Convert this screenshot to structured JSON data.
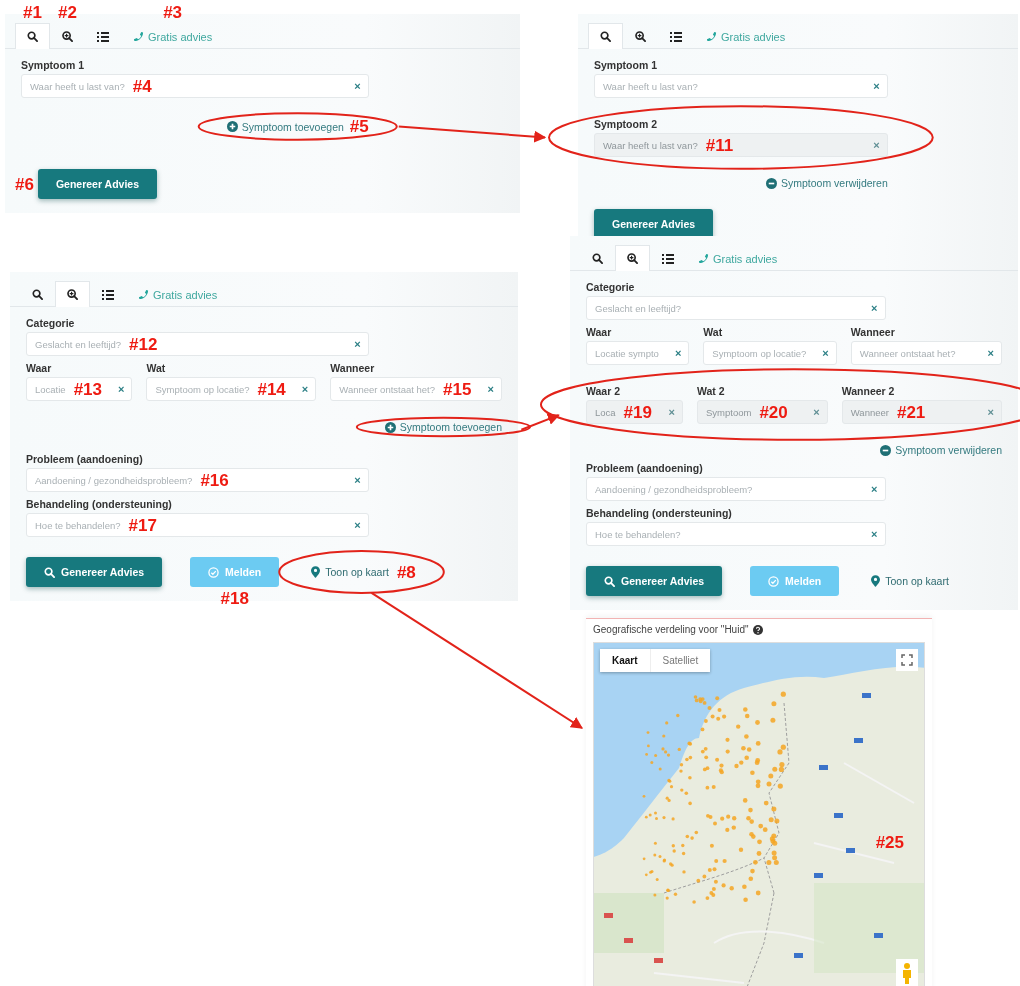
{
  "panels": [
    {
      "tabs": [
        {
          "kind": "search",
          "selected": true,
          "callout": "#1"
        },
        {
          "kind": "zoom",
          "selected": false,
          "callout": "#2"
        },
        {
          "kind": "list",
          "selected": false
        },
        {
          "kind": "phone",
          "label": "Gratis advies",
          "selected": false,
          "callout": "#3"
        }
      ],
      "rows": [
        {
          "kind": "fields",
          "fields": [
            {
              "label": "Symptoom 1",
              "placeholder": "Waar heeft u last van?",
              "clear": "×",
              "disabled": false,
              "callout": "#4"
            }
          ]
        },
        {
          "kind": "add_link",
          "label": "Symptoom toevoegen",
          "callout": "#5"
        }
      ],
      "buttons": [
        {
          "kind": "generate",
          "label": "Genereer Advies",
          "callout": "#6"
        }
      ]
    },
    {
      "tabs": [
        {
          "kind": "search",
          "selected": true
        },
        {
          "kind": "zoom",
          "selected": false
        },
        {
          "kind": "list",
          "selected": false
        },
        {
          "kind": "phone",
          "label": "Gratis advies",
          "selected": false
        }
      ],
      "rows": [
        {
          "kind": "fields",
          "fields": [
            {
              "label": "Symptoom 1",
              "placeholder": "Waar heeft u last van?",
              "clear": "×",
              "disabled": false
            }
          ]
        },
        {
          "kind": "fields",
          "fields": [
            {
              "label": "Symptoom 2",
              "placeholder": "Waar heeft u last van?",
              "clear": "×",
              "disabled": true,
              "callout": "#11"
            }
          ]
        },
        {
          "kind": "remove_link",
          "label": "Symptoom verwijderen"
        }
      ],
      "buttons": [
        {
          "kind": "generate",
          "label": "Genereer Advies"
        }
      ]
    },
    {
      "tabs": [
        {
          "kind": "search",
          "selected": false
        },
        {
          "kind": "zoom",
          "selected": true
        },
        {
          "kind": "list",
          "selected": false
        },
        {
          "kind": "phone",
          "label": "Gratis advies",
          "selected": false
        }
      ],
      "rows": [
        {
          "kind": "fields",
          "fields": [
            {
              "label": "Categorie",
              "placeholder": "Geslacht en leeftijd?",
              "clear": "×",
              "disabled": false,
              "callout": "#12"
            }
          ]
        },
        {
          "kind": "fields",
          "fields": [
            {
              "label": "Waar",
              "placeholder": "Locatie",
              "clear": "×",
              "disabled": false,
              "callout": "#13"
            },
            {
              "label": "Wat",
              "placeholder": "Symptoom op locatie?",
              "clear": "×",
              "disabled": false,
              "callout": "#14"
            },
            {
              "label": "Wanneer",
              "placeholder": "Wanneer ontstaat het?",
              "clear": "×",
              "disabled": false,
              "callout": "#15"
            }
          ]
        },
        {
          "kind": "add_link",
          "label": "Symptoom toevoegen"
        },
        {
          "kind": "fields",
          "fields": [
            {
              "label": "Probleem (aandoening)",
              "placeholder": "Aandoening / gezondheidsprobleem?",
              "clear": "×",
              "disabled": false,
              "callout": "#16"
            }
          ]
        },
        {
          "kind": "fields",
          "fields": [
            {
              "label": "Behandeling (ondersteuning)",
              "placeholder": "Hoe te behandelen?",
              "clear": "×",
              "disabled": false,
              "callout": "#17"
            }
          ]
        }
      ],
      "buttons": [
        {
          "kind": "search",
          "label": "Genereer Advies"
        },
        {
          "kind": "report",
          "label": "Melden",
          "callout": "#18"
        },
        {
          "kind": "map",
          "label": "Toon op kaart",
          "callout": "#8"
        }
      ]
    },
    {
      "tabs": [
        {
          "kind": "search",
          "selected": false
        },
        {
          "kind": "zoom",
          "selected": true
        },
        {
          "kind": "list",
          "selected": false
        },
        {
          "kind": "phone",
          "label": "Gratis advies",
          "selected": false
        }
      ],
      "rows": [
        {
          "kind": "fields",
          "fields": [
            {
              "label": "Categorie",
              "placeholder": "Geslacht en leeftijd?",
              "clear": "×",
              "disabled": false
            }
          ]
        },
        {
          "kind": "fields",
          "fields": [
            {
              "label": "Waar",
              "placeholder": "Locatie sympto",
              "clear": "×",
              "disabled": false
            },
            {
              "label": "Wat",
              "placeholder": "Symptoom op locatie?",
              "clear": "×",
              "disabled": false
            },
            {
              "label": "Wanneer",
              "placeholder": "Wanneer ontstaat het?",
              "clear": "×",
              "disabled": false
            }
          ]
        },
        {
          "kind": "fields",
          "fields": [
            {
              "label": "Waar 2",
              "placeholder": "Loca",
              "clear": "×",
              "disabled": true,
              "callout": "#19"
            },
            {
              "label": "Wat 2",
              "placeholder": "Symptoom",
              "clear": "×",
              "disabled": true,
              "callout": "#20"
            },
            {
              "label": "Wanneer 2",
              "placeholder": "Wanneer",
              "clear": "×",
              "disabled": true,
              "callout": "#21"
            }
          ]
        },
        {
          "kind": "remove_link",
          "label": "Symptoom verwijderen"
        },
        {
          "kind": "fields",
          "fields": [
            {
              "label": "Probleem (aandoening)",
              "placeholder": "Aandoening / gezondheidsprobleem?",
              "clear": "×",
              "disabled": false
            }
          ]
        },
        {
          "kind": "fields",
          "fields": [
            {
              "label": "Behandeling (ondersteuning)",
              "placeholder": "Hoe te behandelen?",
              "clear": "×",
              "disabled": false
            }
          ]
        }
      ],
      "buttons": [
        {
          "kind": "search",
          "label": "Genereer Advies"
        },
        {
          "kind": "report",
          "label": "Melden"
        },
        {
          "kind": "map",
          "label": "Toon op kaart"
        }
      ]
    }
  ],
  "map": {
    "title": "Geografische verdeling voor \"Huid\"",
    "map_types": [
      {
        "label": "Kaart",
        "selected": true
      },
      {
        "label": "Satelliet",
        "selected": false
      }
    ],
    "callout": "#25"
  }
}
